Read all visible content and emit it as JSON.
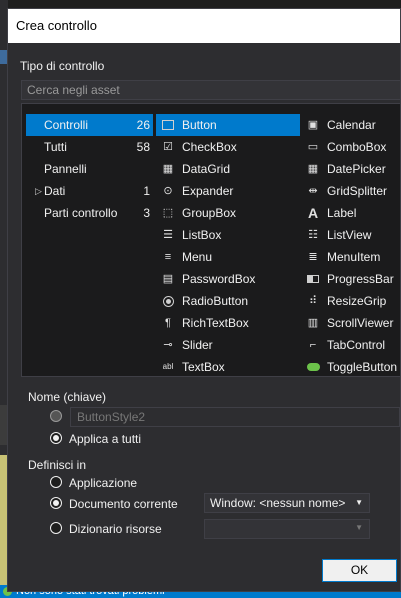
{
  "dialog": {
    "title": "Crea controllo",
    "control_type_label": "Tipo di controllo",
    "search_placeholder": "Cerca negli asset",
    "categories": [
      {
        "name": "Controlli",
        "count": "26",
        "selected": true
      },
      {
        "name": "Tutti",
        "count": "58"
      },
      {
        "name": "Pannelli",
        "count": ""
      },
      {
        "name": "Dati",
        "count": "1",
        "expandable": true
      },
      {
        "name": "Parti controllo",
        "count": "3"
      }
    ],
    "controls_col1": [
      "Button",
      "CheckBox",
      "DataGrid",
      "Expander",
      "GroupBox",
      "ListBox",
      "Menu",
      "PasswordBox",
      "RadioButton",
      "RichTextBox",
      "Slider",
      "TextBox"
    ],
    "controls_col2": [
      "Calendar",
      "ComboBox",
      "DatePicker",
      "GridSplitter",
      "Label",
      "ListView",
      "MenuItem",
      "ProgressBar",
      "ResizeGrip",
      "ScrollViewer",
      "TabControl",
      "ToggleButton"
    ],
    "selected_control": "Button",
    "name_key_label": "Nome (chiave)",
    "name_key_value": "ButtonStyle2",
    "apply_all_label": "Applica a tutti",
    "define_in_label": "Definisci in",
    "option_application": "Applicazione",
    "option_current_document": "Documento corrente",
    "option_resource_dictionary": "Dizionario risorse",
    "document_select_value": "Window: <nessun nome>",
    "ok_label": "OK"
  },
  "background": {
    "status_text": "Non sono stati trovati problemi"
  },
  "colors": {
    "accent": "#007acc",
    "dialog_bg": "#2d2d30",
    "panel_bg": "#1b1b1c"
  }
}
